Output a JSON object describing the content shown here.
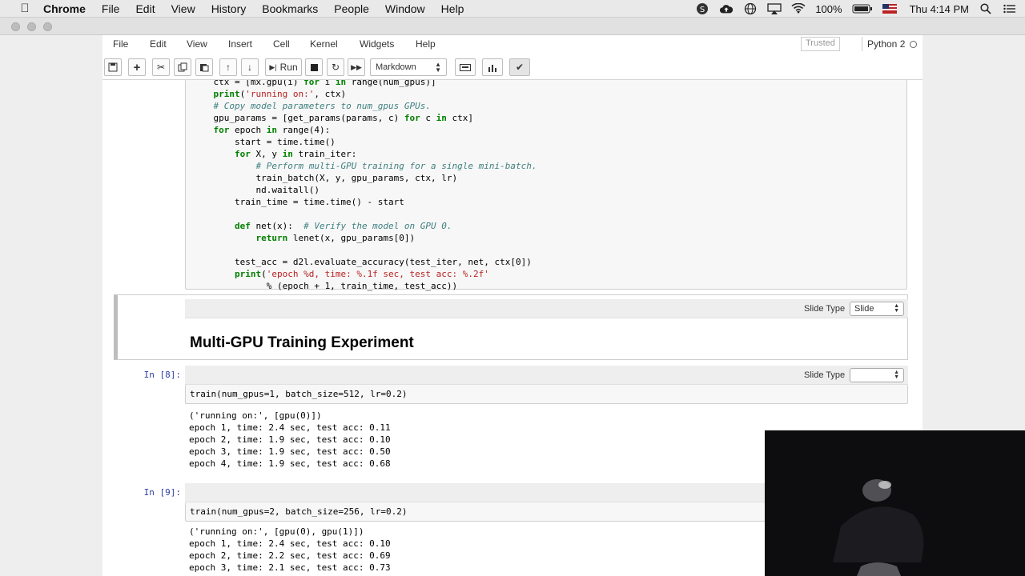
{
  "menubar": {
    "app": "Chrome",
    "items": [
      "File",
      "Edit",
      "View",
      "History",
      "Bookmarks",
      "People",
      "Window",
      "Help"
    ],
    "battery": "100%",
    "clock": "Thu 4:14 PM"
  },
  "jupyter": {
    "menu": [
      "File",
      "Edit",
      "View",
      "Insert",
      "Cell",
      "Kernel",
      "Widgets",
      "Help"
    ],
    "trusted": "Trusted",
    "kernel": "Python 2",
    "toolbar": {
      "run_label": "Run",
      "cell_type": "Markdown"
    }
  },
  "cells": {
    "code_top_lines": [
      "    ctx = [mx.gpu(i) for i in range(num_gpus)]",
      "    print('running on:', ctx)",
      "    # Copy model parameters to num_gpus GPUs.",
      "    gpu_params = [get_params(params, c) for c in ctx]",
      "    for epoch in range(4):",
      "        start = time.time()",
      "        for X, y in train_iter:",
      "            # Perform multi-GPU training for a single mini-batch.",
      "            train_batch(X, y, gpu_params, ctx, lr)",
      "            nd.waitall()",
      "        train_time = time.time() - start",
      "",
      "        def net(x):  # Verify the model on GPU 0.",
      "            return lenet(x, gpu_params[0])",
      "",
      "        test_acc = d2l.evaluate_accuracy(test_iter, net, ctx[0])",
      "        print('epoch %d, time: %.1f sec, test acc: %.2f'",
      "              % (epoch + 1, train_time, test_acc))"
    ],
    "md_slide_type_label": "Slide Type",
    "md_slide_type_value": "Slide",
    "md_heading": "Multi-GPU Training Experiment",
    "cell8": {
      "prompt": "In [8]:",
      "slide_type_label": "Slide Type",
      "slide_type_value": "",
      "code": "train(num_gpus=1, batch_size=512, lr=0.2)",
      "output": [
        "('running on:', [gpu(0)])",
        "epoch 1, time: 2.4 sec, test acc: 0.11",
        "epoch 2, time: 1.9 sec, test acc: 0.10",
        "epoch 3, time: 1.9 sec, test acc: 0.50",
        "epoch 4, time: 1.9 sec, test acc: 0.68"
      ]
    },
    "cell9": {
      "prompt": "In [9]:",
      "code": "train(num_gpus=2, batch_size=256, lr=0.2)",
      "output": [
        "('running on:', [gpu(0), gpu(1)])",
        "epoch 1, time: 2.4 sec, test acc: 0.10",
        "epoch 2, time: 2.2 sec, test acc: 0.69",
        "epoch 3, time: 2.1 sec, test acc: 0.73"
      ]
    }
  }
}
